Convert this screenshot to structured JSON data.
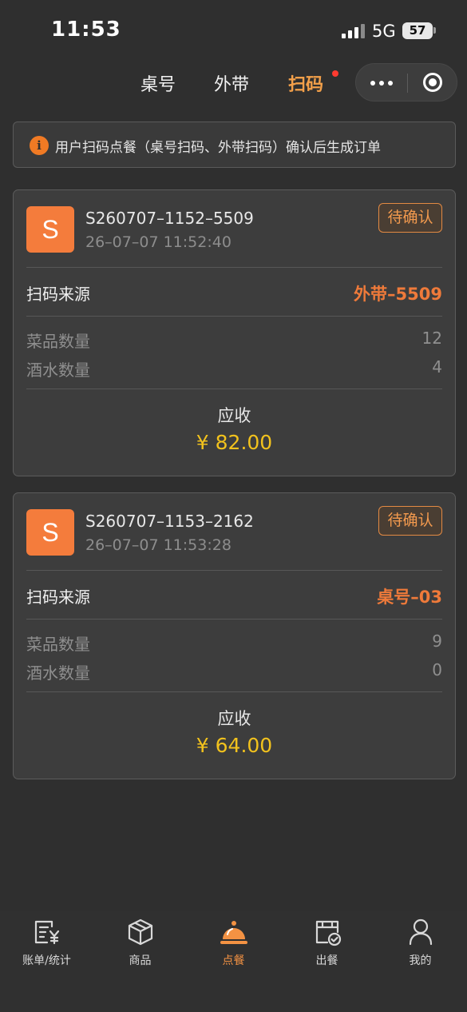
{
  "status_bar": {
    "time": "11:53",
    "network": "5G",
    "battery": "57"
  },
  "tabs": [
    {
      "label": "桌号",
      "active": false
    },
    {
      "label": "外带",
      "active": false
    },
    {
      "label": "扫码",
      "active": true,
      "has_dot": true
    }
  ],
  "capsule": {
    "more_icon": "more-dots-icon",
    "close_icon": "target-circle-icon"
  },
  "notice": {
    "icon": "info-icon",
    "icon_glyph": "i",
    "text": "用户扫码点餐（桌号扫码、外带扫码）确认后生成订单"
  },
  "orders": [
    {
      "avatar_letter": "S",
      "order_no": "S260707–1152–5509",
      "time": "26–07–07 11:52:40",
      "status": "待确认",
      "source_label": "扫码来源",
      "source_value": "外带–5509",
      "dish_label": "菜品数量",
      "dish_count": "12",
      "drink_label": "酒水数量",
      "drink_count": "4",
      "due_label": "应收",
      "due_amount": "¥ 82.00"
    },
    {
      "avatar_letter": "S",
      "order_no": "S260707–1153–2162",
      "time": "26–07–07 11:53:28",
      "status": "待确认",
      "source_label": "扫码来源",
      "source_value": "桌号–03",
      "dish_label": "菜品数量",
      "dish_count": "9",
      "drink_label": "酒水数量",
      "drink_count": "0",
      "due_label": "应收",
      "due_amount": "¥ 64.00"
    }
  ],
  "bottom_nav": [
    {
      "label": "账单/统计",
      "icon": "bill-yen-icon",
      "active": false
    },
    {
      "label": "商品",
      "icon": "box-icon",
      "active": false
    },
    {
      "label": "点餐",
      "icon": "food-cloche-icon",
      "active": true
    },
    {
      "label": "出餐",
      "icon": "serve-check-icon",
      "active": false
    },
    {
      "label": "我的",
      "icon": "user-icon",
      "active": false
    }
  ],
  "colors": {
    "background": "#2f2f2f",
    "accent_orange": "#f3a04a",
    "source_orange": "#ef7a3a",
    "amount_yellow": "#f2c21d",
    "avatar_orange": "#f47c3c",
    "badge_dot": "#ff3b30"
  }
}
